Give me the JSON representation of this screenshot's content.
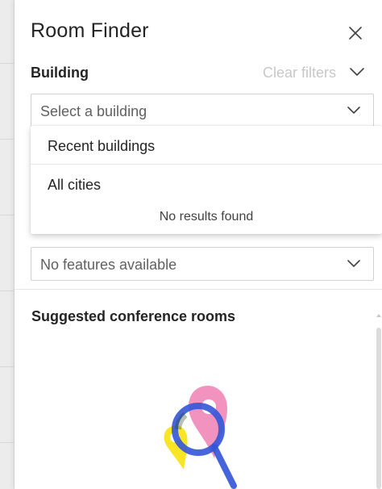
{
  "panel": {
    "title": "Room Finder",
    "close_icon": "close-icon"
  },
  "building": {
    "label": "Building",
    "clear_filters": "Clear filters",
    "placeholder": "Select a building"
  },
  "dropdown": {
    "items": [
      {
        "label": "Recent buildings"
      },
      {
        "label": "All cities"
      }
    ],
    "empty_message": "No results found"
  },
  "features": {
    "placeholder": "No features available"
  },
  "suggested": {
    "title": "Suggested conference rooms"
  },
  "colors": {
    "pin_pink": "#ee7fb4",
    "pin_yellow": "#f7e526",
    "magnifier_blue": "#3355d8"
  }
}
